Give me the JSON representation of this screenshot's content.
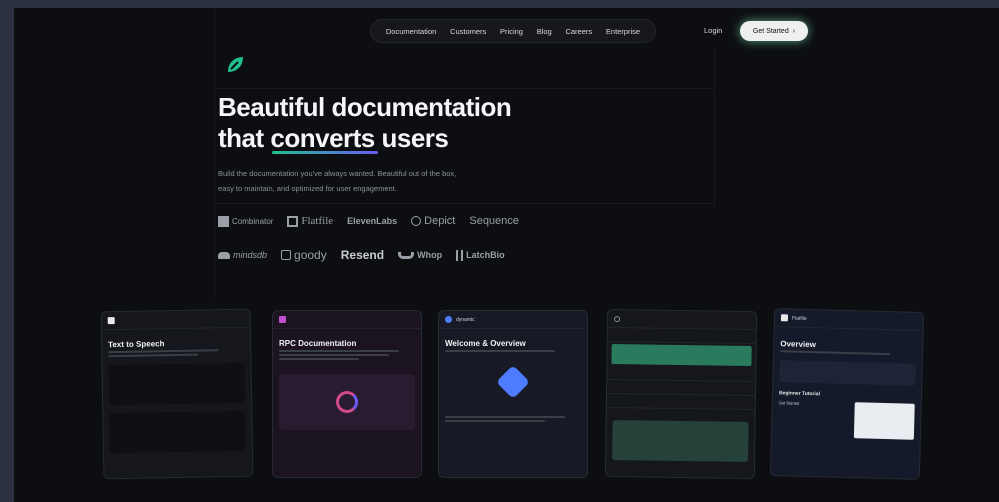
{
  "nav": {
    "items": [
      "Documentation",
      "Customers",
      "Pricing",
      "Blog",
      "Careers",
      "Enterprise"
    ],
    "login": "Login",
    "cta": "Get Started",
    "cta_arrow": "›"
  },
  "hero": {
    "headline_line1": "Beautiful documentation",
    "headline_line2": "that converts users",
    "subtitle_line1": "Build the documentation you've always wanted. Beautiful out of the box,",
    "subtitle_line2": "easy to maintain, and optimized for user engagement."
  },
  "customers_row1": [
    "Combinator",
    "Flatfile",
    "ElevenLabs",
    "Depict",
    "Sequence"
  ],
  "customers_row2": [
    "mindsdb",
    "goody",
    "Resend",
    "Whop",
    "LatchBio"
  ],
  "cards": [
    {
      "tag": "Text to Speech",
      "title": "Text to Speech"
    },
    {
      "tag": "RPC",
      "title": "RPC Documentation"
    },
    {
      "tag": "dynamic",
      "title": "Welcome & Overview"
    },
    {
      "tag": "",
      "title": ""
    },
    {
      "tag": "Flatfile",
      "title": "Overview",
      "sub": "Beginner Tutorial",
      "link": "Get Started"
    }
  ],
  "colors": {
    "accent_green": "#1fbf8f",
    "accent_purple": "#6a5cf5",
    "background": "#0d0e11",
    "frame": "#2b3140"
  }
}
